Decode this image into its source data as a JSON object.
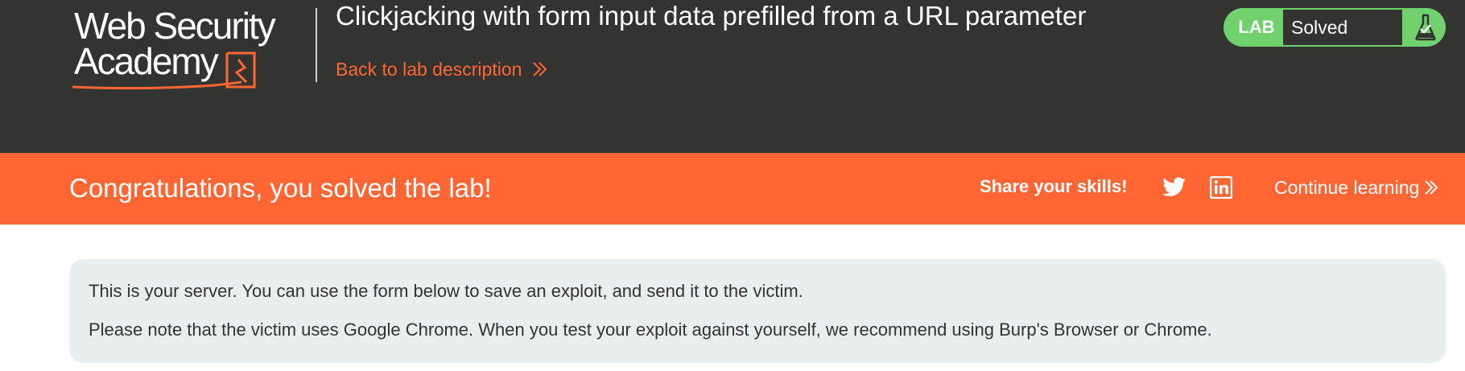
{
  "header": {
    "logo_text_line1": "Web Security",
    "logo_text_line2": "Academy",
    "lab_title": "Clickjacking with form input data prefilled from a URL parameter",
    "back_link_label": "Back to lab description"
  },
  "status": {
    "badge": "LAB",
    "text": "Solved",
    "icon": "flask-icon"
  },
  "banner": {
    "message": "Congratulations, you solved the lab!",
    "share_label": "Share your skills!",
    "share_icons": [
      "twitter-icon",
      "linkedin-icon"
    ],
    "continue_label": "Continue learning"
  },
  "info": {
    "line1": "This is your server. You can use the form below to save an exploit, and send it to the victim.",
    "line2": "Please note that the victim uses Google Chrome. When you test your exploit against yourself, we recommend using Burp's Browser or Chrome."
  },
  "colors": {
    "header_bg": "#333332",
    "accent": "#ff6633",
    "solved_green": "#70d16d",
    "info_bg": "#e9eef0"
  }
}
